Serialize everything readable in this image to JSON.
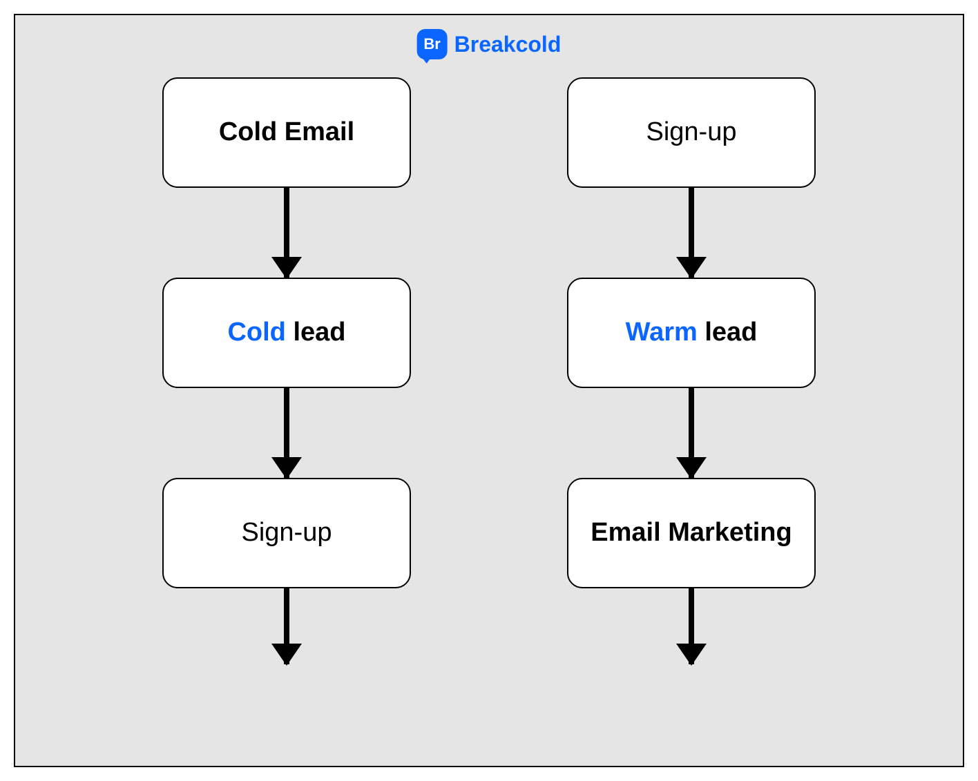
{
  "brand": {
    "icon_text": "Br",
    "name": "Breakcold"
  },
  "colors": {
    "accent": "#0a66ff",
    "canvas_bg": "#e5e5e5",
    "text": "#000000"
  },
  "columns": {
    "left": {
      "nodes": [
        {
          "text": "Cold Email",
          "bold": true
        },
        {
          "accent": "Cold",
          "rest": " lead"
        },
        {
          "text": "Sign-up",
          "bold": false
        }
      ]
    },
    "right": {
      "nodes": [
        {
          "text": "Sign-up",
          "bold": false
        },
        {
          "accent": "Warm",
          "rest": " lead"
        },
        {
          "text": "Email Marketing",
          "bold": true
        }
      ]
    }
  }
}
